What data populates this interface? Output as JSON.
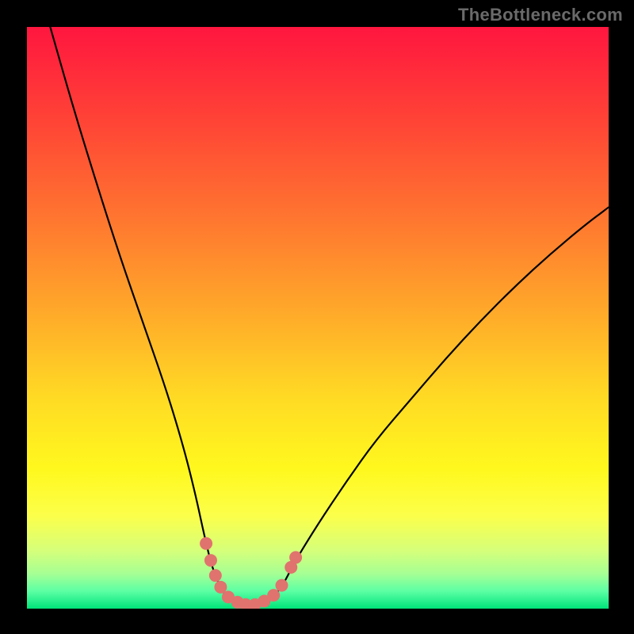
{
  "watermark": "TheBottleneck.com",
  "chart_data": {
    "type": "line",
    "title": "",
    "xlabel": "",
    "ylabel": "",
    "xlim": [
      0,
      100
    ],
    "ylim": [
      0,
      100
    ],
    "grid": false,
    "legend": false,
    "background_gradient": {
      "stops": [
        {
          "offset": 0.0,
          "color": "#ff163f"
        },
        {
          "offset": 0.16,
          "color": "#ff4336"
        },
        {
          "offset": 0.32,
          "color": "#ff7330"
        },
        {
          "offset": 0.48,
          "color": "#ffa62a"
        },
        {
          "offset": 0.64,
          "color": "#ffdb24"
        },
        {
          "offset": 0.76,
          "color": "#fff81e"
        },
        {
          "offset": 0.84,
          "color": "#fcff4a"
        },
        {
          "offset": 0.9,
          "color": "#d6ff7a"
        },
        {
          "offset": 0.94,
          "color": "#a6ff94"
        },
        {
          "offset": 0.97,
          "color": "#5cffa4"
        },
        {
          "offset": 1.0,
          "color": "#00e47a"
        }
      ]
    },
    "series": [
      {
        "name": "bottleneck-curve",
        "color": "#000000",
        "width": 2.2,
        "points": [
          {
            "x": 4.0,
            "y": 100.0
          },
          {
            "x": 8.0,
            "y": 86.0
          },
          {
            "x": 12.0,
            "y": 73.0
          },
          {
            "x": 16.0,
            "y": 60.5
          },
          {
            "x": 20.0,
            "y": 49.0
          },
          {
            "x": 24.0,
            "y": 37.5
          },
          {
            "x": 27.0,
            "y": 27.5
          },
          {
            "x": 29.0,
            "y": 19.5
          },
          {
            "x": 30.5,
            "y": 12.5
          },
          {
            "x": 32.0,
            "y": 6.4
          },
          {
            "x": 34.0,
            "y": 2.2
          },
          {
            "x": 36.0,
            "y": 0.6
          },
          {
            "x": 38.0,
            "y": 0.2
          },
          {
            "x": 40.0,
            "y": 0.5
          },
          {
            "x": 42.0,
            "y": 1.6
          },
          {
            "x": 44.0,
            "y": 4.0
          },
          {
            "x": 46.0,
            "y": 8.0
          },
          {
            "x": 50.0,
            "y": 14.5
          },
          {
            "x": 55.0,
            "y": 22.0
          },
          {
            "x": 60.0,
            "y": 29.0
          },
          {
            "x": 66.0,
            "y": 36.0
          },
          {
            "x": 72.0,
            "y": 43.0
          },
          {
            "x": 78.0,
            "y": 49.5
          },
          {
            "x": 84.0,
            "y": 55.5
          },
          {
            "x": 90.0,
            "y": 61.0
          },
          {
            "x": 96.0,
            "y": 66.0
          },
          {
            "x": 100.0,
            "y": 69.0
          }
        ]
      }
    ],
    "markers": {
      "name": "highlight-dots",
      "color": "#e0736e",
      "radius": 8,
      "points": [
        {
          "x": 30.8,
          "y": 11.2
        },
        {
          "x": 31.6,
          "y": 8.3
        },
        {
          "x": 32.4,
          "y": 5.7
        },
        {
          "x": 33.3,
          "y": 3.7
        },
        {
          "x": 34.6,
          "y": 2.0
        },
        {
          "x": 36.2,
          "y": 1.1
        },
        {
          "x": 37.6,
          "y": 0.7
        },
        {
          "x": 39.2,
          "y": 0.7
        },
        {
          "x": 40.8,
          "y": 1.3
        },
        {
          "x": 42.4,
          "y": 2.3
        },
        {
          "x": 43.8,
          "y": 4.0
        },
        {
          "x": 45.4,
          "y": 7.1
        },
        {
          "x": 46.2,
          "y": 8.8
        }
      ]
    }
  }
}
